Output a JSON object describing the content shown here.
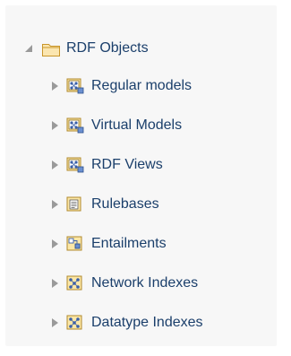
{
  "tree": {
    "root": {
      "label": "RDF Objects",
      "icon": "folder-icon",
      "expanded": true
    },
    "children": [
      {
        "label": "Regular models",
        "icon": "model-icon",
        "expanded": false
      },
      {
        "label": "Virtual Models",
        "icon": "model-icon",
        "expanded": false
      },
      {
        "label": "RDF Views",
        "icon": "model-icon",
        "expanded": false
      },
      {
        "label": "Rulebases",
        "icon": "rulebase-icon",
        "expanded": false
      },
      {
        "label": "Entailments",
        "icon": "entailment-icon",
        "expanded": false
      },
      {
        "label": "Network Indexes",
        "icon": "index-icon",
        "expanded": false
      },
      {
        "label": "Datatype Indexes",
        "icon": "index-icon",
        "expanded": false
      }
    ]
  },
  "colors": {
    "label": "#1b3f6b",
    "panel_background": "#f7f7f7",
    "folder": "#e2a93a",
    "arrow": "#9a9a9a"
  }
}
